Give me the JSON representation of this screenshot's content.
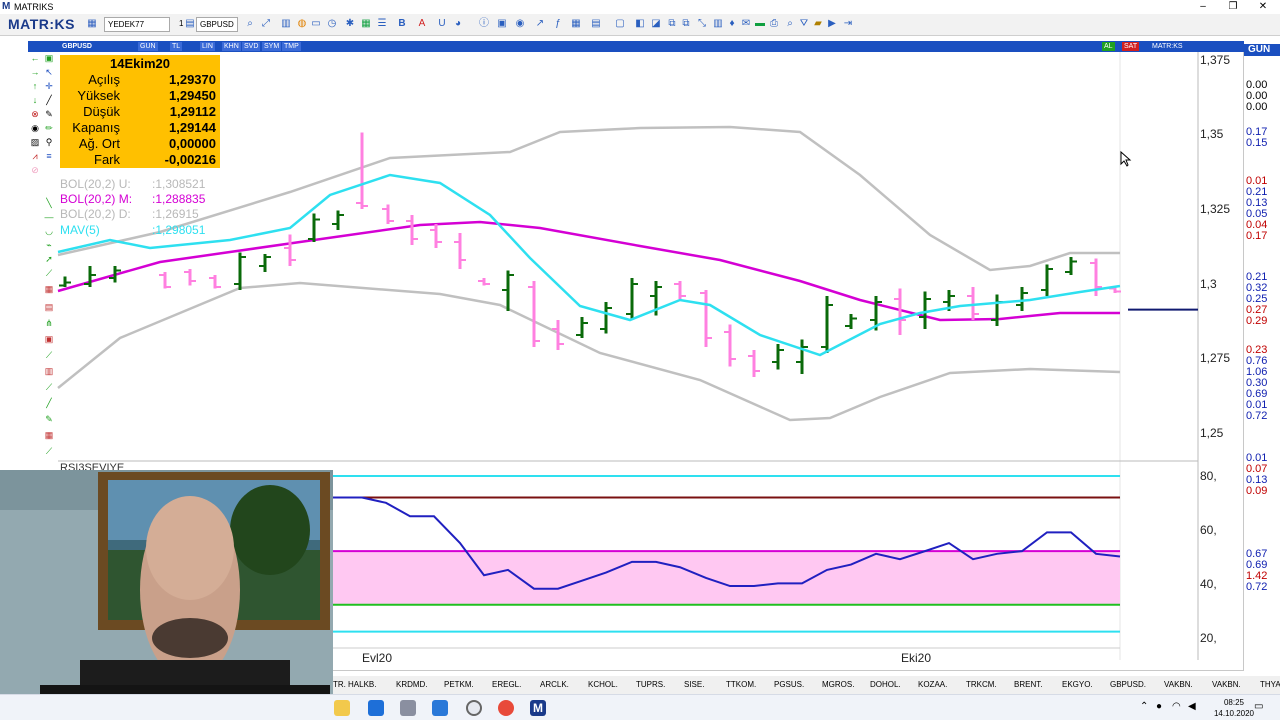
{
  "window": {
    "title": "MATRIKS",
    "minimize": "–",
    "restore": "❐",
    "close": "✕"
  },
  "toolbar": {
    "brand": "MATR:KS",
    "workspace": "YEDEK77",
    "layout_num": "1",
    "symbol": "GBPUSD"
  },
  "chart_header": {
    "symbol": "GBPUSD",
    "buttons": [
      "GUN",
      "TL",
      "LIN",
      "KHN",
      "SVD",
      "SYM",
      "TMP"
    ],
    "right_buttons": [
      "AL",
      "SAT",
      "MATR:KS"
    ],
    "period": "GUN"
  },
  "infobox": {
    "date": "14Ekim20",
    "rows": [
      {
        "label": "Açılış",
        "value": "1,29370"
      },
      {
        "label": "Yüksek",
        "value": "1,29450"
      },
      {
        "label": "Düşük",
        "value": "1,29112"
      },
      {
        "label": "Kapanış",
        "value": "1,29144"
      },
      {
        "label": "Ağ. Ort",
        "value": "0,00000"
      },
      {
        "label": "Fark",
        "value": "-0,00216"
      }
    ]
  },
  "indicators": [
    {
      "label": "BOL(20,2) U:",
      "value": ":1,308521",
      "color": "#b8b8b8"
    },
    {
      "label": "BOL(20,2) M:",
      "value": ":1,288835",
      "color": "#d400d4"
    },
    {
      "label": "BOL(20,2) D:",
      "value": ":1,26915",
      "color": "#b8b8b8"
    },
    {
      "label": "MAV(5)",
      "value": ":1,298051",
      "color": "#2ee0f0"
    }
  ],
  "price_axis": [
    "1,375",
    "1,35",
    "1,325",
    "1,3",
    "1,275",
    "1,25"
  ],
  "rsi_axis": [
    "80,",
    "60,",
    "40,",
    "20,"
  ],
  "rsi_label": "RSI3SEVIYE",
  "date_axis": [
    {
      "label": "Evl20"
    },
    {
      "label": "Eki20"
    }
  ],
  "right_column_top": [
    {
      "v": "0.00",
      "c": "#000"
    },
    {
      "v": "0.00",
      "c": "#000"
    },
    {
      "v": "0.00",
      "c": "#000"
    },
    {
      "v": "0.17",
      "c": "#1020b0"
    },
    {
      "v": "0.15",
      "c": "#1020b0"
    },
    {
      "v": "0.01",
      "c": "#c00000"
    },
    {
      "v": "0.21",
      "c": "#1020b0"
    },
    {
      "v": "0.13",
      "c": "#1020b0"
    },
    {
      "v": "0.05",
      "c": "#1020b0"
    },
    {
      "v": "0.04",
      "c": "#c00000"
    },
    {
      "v": "0.17",
      "c": "#c00000"
    },
    {
      "v": "0.21",
      "c": "#1020b0"
    },
    {
      "v": "0.32",
      "c": "#1020b0"
    },
    {
      "v": "0.25",
      "c": "#1020b0"
    },
    {
      "v": "0.27",
      "c": "#c00000"
    },
    {
      "v": "0.29",
      "c": "#c00000"
    },
    {
      "v": "0.23",
      "c": "#c00000"
    },
    {
      "v": "0.76",
      "c": "#1020b0"
    },
    {
      "v": "1.06",
      "c": "#1020b0"
    },
    {
      "v": "0.30",
      "c": "#1020b0"
    },
    {
      "v": "0.69",
      "c": "#1020b0"
    },
    {
      "v": "0.01",
      "c": "#1020b0"
    },
    {
      "v": "0.72",
      "c": "#1020b0"
    }
  ],
  "right_column_bottom": [
    {
      "v": "0.01",
      "c": "#1020b0"
    },
    {
      "v": "0.07",
      "c": "#c00000"
    },
    {
      "v": "0.13",
      "c": "#1020b0"
    },
    {
      "v": "0.09",
      "c": "#c00000"
    },
    {
      "v": "0.67",
      "c": "#1020b0"
    },
    {
      "v": "0.69",
      "c": "#1020b0"
    },
    {
      "v": "1.42",
      "c": "#c00000"
    },
    {
      "v": "0.72",
      "c": "#1020b0"
    }
  ],
  "bottom_tabs": [
    "TR.",
    "HALKB.",
    "KRDMD.",
    "PETKM.",
    "EREGL.",
    "ARCLK.",
    "KCHOL.",
    "TUPRS.",
    "SISE.",
    "TTKOM.",
    "PGSUS.",
    "MGROS.",
    "DOHOL.",
    "KOZAA.",
    "TRKCM.",
    "BRENT.",
    "EKGYO.",
    "GBPUSD.",
    "VAKBN.",
    "VAKBN.",
    "THYAO."
  ],
  "taskbar": {
    "time": "08:25",
    "date": "14.10.2020"
  },
  "colors": {
    "titlebar_blue": "#1a4fc0",
    "infobox": "#ffc000",
    "up_bar": "#0a6a0a",
    "down_bar": "#ff80e0",
    "bol_band": "#c0c0c0",
    "bol_mid": "#d400d4",
    "mav": "#2ee0f0",
    "rsi_line": "#2020c0",
    "rsi_zone": "#ffc8f2"
  }
}
